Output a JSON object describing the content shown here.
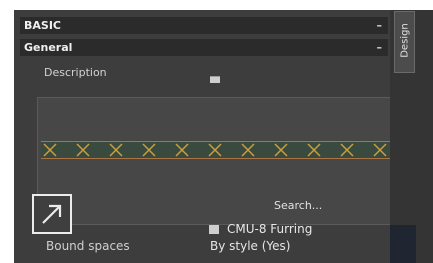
{
  "sections": {
    "basic": {
      "label": "BASIC",
      "toggle": "–"
    },
    "general": {
      "label": "General",
      "toggle": "–"
    }
  },
  "description": {
    "label": "Description",
    "icon": "description-icon"
  },
  "preview": {
    "search_label": "Search..."
  },
  "style": {
    "value": "CMU-8 Furring",
    "icon": "wall-style-icon"
  },
  "bound_spaces": {
    "label": "Bound spaces",
    "value": "By style (Yes)"
  },
  "side_tab": {
    "label": "Design"
  },
  "colors": {
    "panel_bg": "#3d3d3d",
    "header_bg": "#2b2b2b",
    "strip_border": "#aa7444",
    "hatch_x": "#c8a040"
  }
}
